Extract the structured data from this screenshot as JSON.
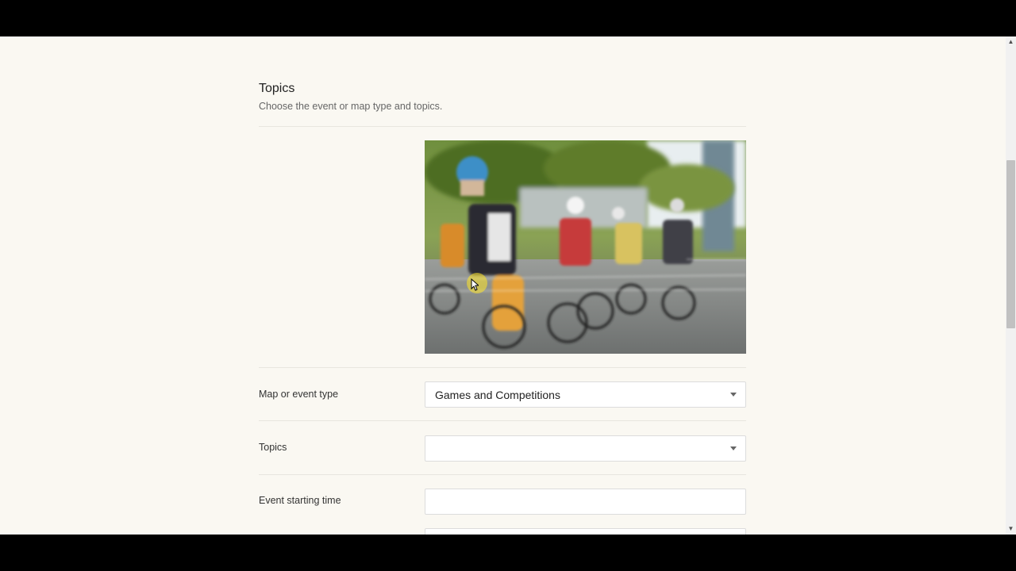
{
  "section": {
    "title": "Topics",
    "subtitle": "Choose the event or map type and topics."
  },
  "image": {
    "icon": "cycling-race-photo"
  },
  "fields": {
    "map_type": {
      "label": "Map or event type",
      "value": "Games and Competitions"
    },
    "topics": {
      "label": "Topics",
      "value": ""
    },
    "start_time": {
      "label": "Event starting time",
      "value": ""
    }
  },
  "colors": {
    "page_background": "#faf8f2",
    "field_border": "#dcdcdc",
    "cursor_highlight": "#ffe628"
  }
}
